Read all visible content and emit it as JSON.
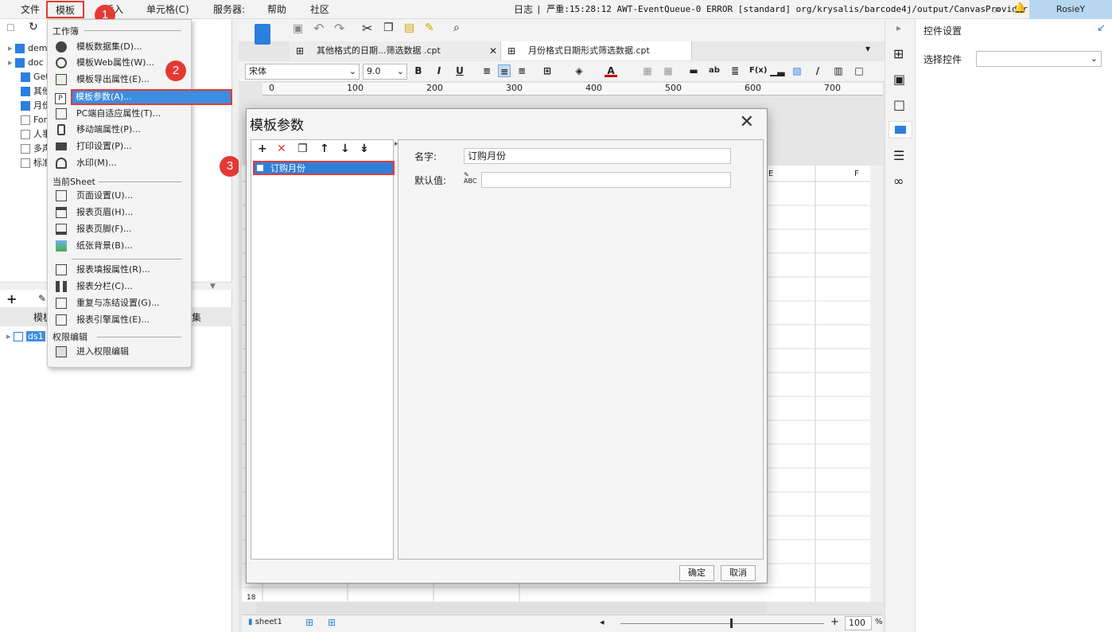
{
  "menubar": {
    "items": [
      "文件",
      "模板",
      "插入",
      "单元格(C)",
      "服务器:",
      "帮助",
      "社区"
    ],
    "log_label": "日志",
    "log_text": "| 严重:15:28:12 AWT-EventQueue-0 ERROR [standard] org/krysalis/barcode4j/output/CanvasProvider",
    "user": "RosieY"
  },
  "badges": [
    "1",
    "2",
    "3"
  ],
  "left_tree": {
    "rows": [
      "dem",
      "doc",
      "Get",
      "其他",
      "月份",
      "For",
      "人事",
      "多声",
      "标准"
    ],
    "bottom_tab": "模板",
    "bottom_tab2": "集",
    "ds_item": "ds1"
  },
  "dropdown": {
    "section1": "工作簿",
    "items1": [
      "模板数据集(D)...",
      "模板Web属性(W)...",
      "模板导出属性(E)...",
      "模板参数(A)...",
      "PC端自适应属性(T)...",
      "移动端属性(P)...",
      "打印设置(P)...",
      "水印(M)..."
    ],
    "section2": "当前Sheet",
    "items2": [
      "页面设置(U)...",
      "报表页眉(H)...",
      "报表页脚(F)...",
      "纸张背景(B)..."
    ],
    "items3": [
      "报表填报属性(R)...",
      "报表分栏(C)...",
      "重复与冻结设置(G)...",
      "报表引擎属性(E)..."
    ],
    "section3": "权限编辑",
    "items4": [
      "进入权限编辑"
    ]
  },
  "tabs": [
    "其他格式的日期...筛选数据 .cpt",
    "月份格式日期形式筛选数据.cpt"
  ],
  "format": {
    "font": "宋体",
    "size": "9.0"
  },
  "ruler": [
    "0",
    "100",
    "200",
    "300",
    "400",
    "500",
    "600",
    "700"
  ],
  "grid": {
    "col_e": "E",
    "col_f": "F",
    "row_label": "18"
  },
  "right_panel": {
    "title": "控件设置",
    "select_label": "选择控件"
  },
  "dialog": {
    "title": "模板参数",
    "param": "订购月份",
    "name_label": "名字:",
    "name_value": "订购月份",
    "default_label": "默认值:",
    "default_value": "",
    "ok": "确定",
    "cancel": "取消"
  },
  "status": {
    "sheet": "sheet1",
    "zoom": "100",
    "zoom_unit": "%"
  }
}
